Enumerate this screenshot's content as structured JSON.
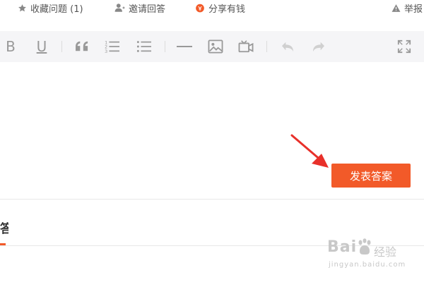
{
  "top_actions": {
    "favorite": "收藏问题 (1)",
    "invite": "邀请回答",
    "share": "分享有钱",
    "report": "举报"
  },
  "toolbar": {
    "bold": "B",
    "underline": "U"
  },
  "editor": {
    "publish_label": "发表答案"
  },
  "tabs": {
    "answers_label": "答"
  },
  "watermark": {
    "brand": "Bai",
    "brand_suffix": "经验",
    "url": "jingyan.baidu.com"
  },
  "colors": {
    "accent": "#f25a29",
    "toolbar_bg": "#f5f5f7",
    "icon": "#999999"
  }
}
